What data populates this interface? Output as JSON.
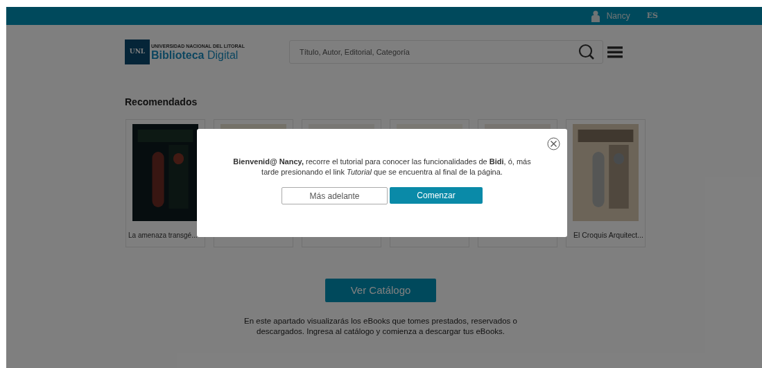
{
  "top_bar": {
    "user": "Nancy",
    "language": "ES"
  },
  "logo": {
    "badge": "UNL",
    "university": "UNIVERSIDAD NACIONAL DEL LITORAL",
    "title_bold": "Biblioteca",
    "title_light": "Digital"
  },
  "search": {
    "placeholder": "Título, Autor, Editorial, Categoría"
  },
  "recommended": {
    "title": "Recomendados",
    "books": [
      {
        "kind": "picture",
        "title": "La amenaza transgé..."
      },
      {
        "kind": "picture"
      },
      {
        "kind": "picture"
      },
      {
        "kind": "picture"
      },
      {
        "kind": "picture"
      },
      {
        "kind": "picture",
        "title": "El Croquis Arquitect..."
      }
    ]
  },
  "catalog_button": "Ver Catálogo",
  "info_text": "En este apartado visualizarás los eBooks que tomes prestados, reservados o descargados. Ingresa al catálogo y comienza a descargar tus eBooks.",
  "dialog": {
    "message": "**Bienvenid@ Nancy,** recorre el tutorial para conocer las funcionalidades de **Bidi**, ó, más tarde presionando el link *Tutorial* que se encuentra al final de la página.",
    "buttons": [
      "Más adelante",
      "Comenzar"
    ]
  }
}
